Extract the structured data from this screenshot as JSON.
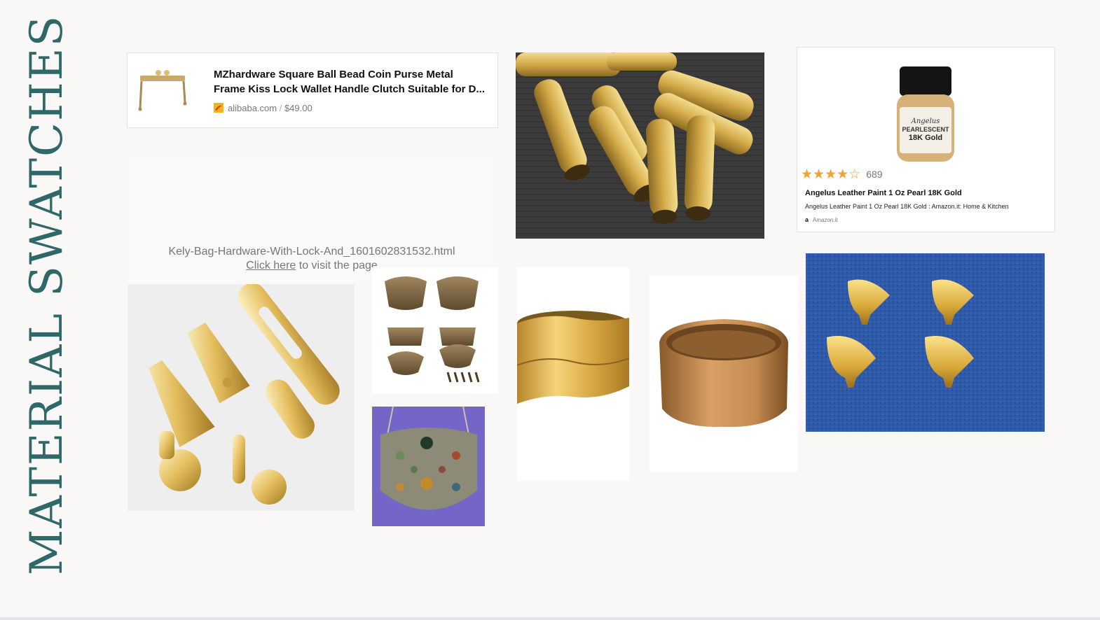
{
  "board": {
    "side_title": "MATERIAL SWATCHES"
  },
  "link_card": {
    "title_line1": "MZhardware Square Ball Bead Coin Purse Metal",
    "title_line2": "Frame Kiss Lock Wallet Handle Clutch Suitable for D...",
    "source": "alibaba.com",
    "separator": " / ",
    "price": "$49.00"
  },
  "embed_placeholder": {
    "filename": "Kely-Bag-Hardware-With-Lock-And_1601602831532.html",
    "click_link": "Click here",
    "suffix": " to visit the page"
  },
  "amazon_card": {
    "product_label_brand": "Angelus",
    "product_label_line1": "PEARLESCENT",
    "product_label_line2": "18K Gold",
    "rating": 4.5,
    "review_count": "689",
    "title": "Angelus Leather Paint 1 Oz Pearl 18K Gold",
    "description": "Angelus Leather Paint 1 Oz Pearl 18K Gold : Amazon.it: Home & Kitchen",
    "source": "Amazon.it"
  },
  "images": [
    {
      "name": "purse-frame-thumbnail"
    },
    {
      "name": "gold-tube-beads-photo"
    },
    {
      "name": "gold-zipper-pulls-photo"
    },
    {
      "name": "bronze-latches-photo"
    },
    {
      "name": "jeweled-coin-purse-photo"
    },
    {
      "name": "gold-wavy-ring-photo"
    },
    {
      "name": "rose-gold-band-ring-photo"
    },
    {
      "name": "gold-corner-feet-photo"
    }
  ],
  "colors": {
    "title": "#2f6868",
    "background": "#f9f8f7",
    "star": "#f0a13a"
  }
}
